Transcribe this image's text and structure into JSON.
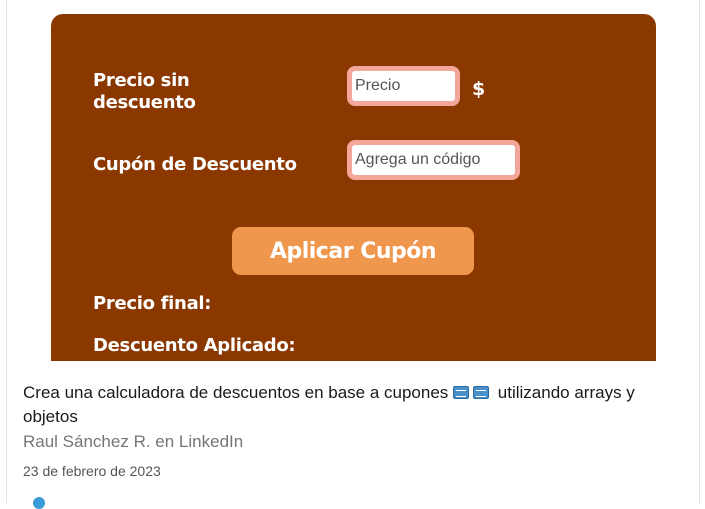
{
  "preview": {
    "labels": {
      "price": "Precio sin\ndescuento",
      "coupon": "Cupón de Descuento",
      "final_price": "Precio final:",
      "discount_applied": "Descuento Aplicado:"
    },
    "price_input": {
      "placeholder": "Precio",
      "value": ""
    },
    "currency_symbol": "$",
    "coupon_input": {
      "placeholder": "Agrega un código",
      "value": ""
    },
    "apply_button": "Aplicar Cupón",
    "colors": {
      "background": "#8b3800",
      "button": "#f0974e",
      "input_border": "#f3a79a"
    }
  },
  "post": {
    "title_before": "Crea una calculadora de descuentos en base a cupones",
    "title_after": "utilizando arrays y objetos",
    "title_emojis": [
      "ticket-emoji",
      "ticket-emoji"
    ],
    "source": "Raul Sánchez R. en LinkedIn",
    "date": "23 de febrero de 2023"
  }
}
